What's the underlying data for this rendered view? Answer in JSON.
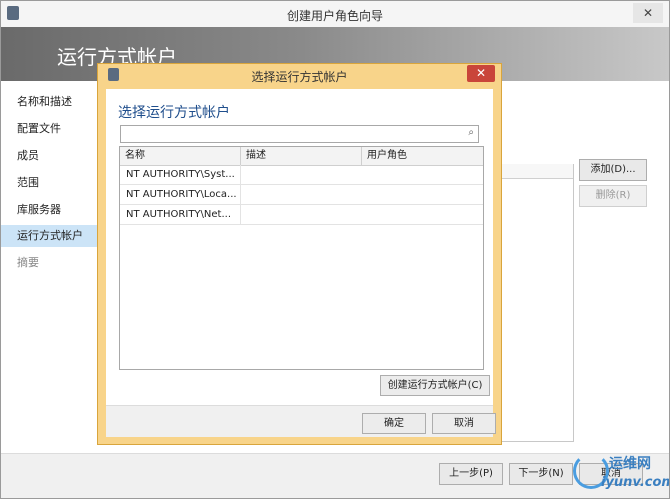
{
  "window": {
    "title": "创建用户角色向导"
  },
  "banner": {
    "title": "运行方式帐户"
  },
  "nav": {
    "items": [
      {
        "label": "名称和描述"
      },
      {
        "label": "配置文件"
      },
      {
        "label": "成员"
      },
      {
        "label": "范围"
      },
      {
        "label": "库服务器"
      },
      {
        "label": "运行方式帐户"
      },
      {
        "label": "摘要"
      }
    ]
  },
  "background": {
    "add_label": "添加(D)...",
    "remove_label": "删除(R)"
  },
  "footer": {
    "prev_label": "上一步(P)",
    "next_label": "下一步(N)",
    "cancel_label": "取消"
  },
  "dialog": {
    "title": "选择运行方式帐户",
    "heading": "选择运行方式帐户",
    "search": {
      "value": "",
      "placeholder": ""
    },
    "columns": [
      "名称",
      "描述",
      "用户角色"
    ],
    "rows": [
      {
        "name": "NT AUTHORITY\\Syst..."
      },
      {
        "name": "NT AUTHORITY\\Loca..."
      },
      {
        "name": "NT AUTHORITY\\Net..."
      }
    ],
    "create_label": "创建运行方式帐户(C)",
    "ok_label": "确定",
    "cancel_label": "取消"
  },
  "watermark": {
    "line1": "运维网",
    "line2": "iyunv.com"
  }
}
